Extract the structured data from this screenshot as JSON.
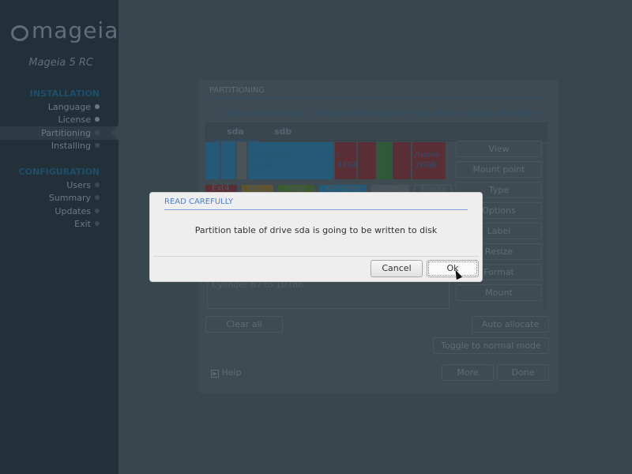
{
  "sidebar": {
    "logo": "mageia",
    "version": "Mageia 5 RC",
    "sections": [
      {
        "title": "INSTALLATION",
        "items": [
          "Language",
          "License",
          "Partitioning",
          "Installing"
        ]
      },
      {
        "title": "CONFIGURATION",
        "items": [
          "Users",
          "Summary",
          "Updates",
          "Exit"
        ]
      }
    ],
    "active_item": "Partitioning"
  },
  "panel": {
    "title": "PARTITIONING",
    "hint": "Click on a partition, choose a filesystem type then choose an action",
    "tabs": [
      "sda",
      "sdb"
    ],
    "selected_tab": "sda",
    "partitions": [
      {
        "label": "...",
        "size": "...",
        "color": "#245a78"
      },
      {
        "label": "...",
        "size": "...",
        "color": "#245a78"
      },
      {
        "label": "",
        "size": "",
        "color": "#4a5358"
      },
      {
        "label": "/media/win_c",
        "size": "82GB",
        "color": "#245a78"
      },
      {
        "label": "/",
        "size": "14GB",
        "color": "#5a2e35"
      },
      {
        "label": "",
        "size": "",
        "color": "#5a2e35"
      },
      {
        "label": "",
        "size": "",
        "color": "#2f5a38"
      },
      {
        "label": "",
        "size": "",
        "color": "#5a2e35"
      },
      {
        "label": "/home",
        "size": "26GB",
        "color": "#5a2e35"
      }
    ],
    "legend": [
      {
        "label": "Ext4",
        "color": "#5a2e35"
      },
      {
        "label": "XFS",
        "color": "#5e5530"
      },
      {
        "label": "Swap",
        "color": "#3b5a30"
      },
      {
        "label": "Windows",
        "color": "#245a78"
      },
      {
        "label": "Other",
        "color": "#4a5358"
      },
      {
        "label": "Empty",
        "color": "#3f4b52"
      }
    ],
    "actions": [
      "View",
      "Mount point",
      "Type",
      "Options",
      "Label",
      "Resize",
      "Format",
      "Mount"
    ],
    "info": "Cylinder 67 to 10786",
    "clear_all": "Clear all",
    "auto_allocate": "Auto allocate",
    "toggle_mode": "Toggle to normal mode",
    "help": "Help",
    "more": "More",
    "done": "Done"
  },
  "dialog": {
    "title": "READ CAREFULLY",
    "message": "Partition table of drive sda is going to be written to disk",
    "cancel": "Cancel",
    "ok": "Ok"
  }
}
